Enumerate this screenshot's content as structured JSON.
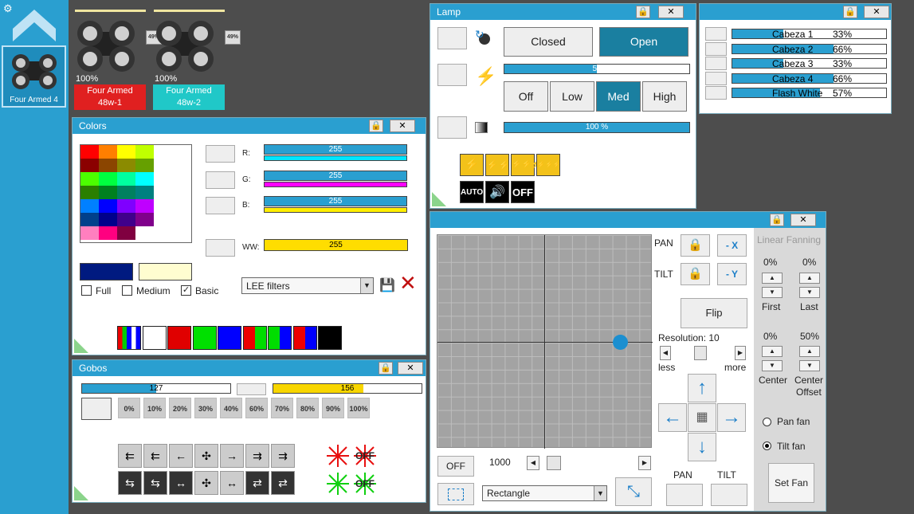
{
  "sidebar": {
    "item_label": "Four Armed 4"
  },
  "fixtures": [
    {
      "pct": "100%",
      "badge": "49%",
      "name_line1": "Four Armed",
      "name_line2": "48w-1",
      "color": "#e02020"
    },
    {
      "pct": "100%",
      "badge": "49%",
      "name_line1": "Four Armed",
      "name_line2": "48w-2",
      "color": "#20c8c8"
    }
  ],
  "colors_win": {
    "title": "Colors",
    "palette": [
      "#ff0000",
      "#ff7f00",
      "#ffff00",
      "#bfff00",
      "#8b0000",
      "#8b4500",
      "#8b8b00",
      "#66a000",
      "#4cff00",
      "#00ff40",
      "#00ff9f",
      "#00ffff",
      "#2a7f00",
      "#00801f",
      "#00805f",
      "#008080",
      "#0080ff",
      "#0000ff",
      "#7f00ff",
      "#bf00ff",
      "#00408b",
      "#00008b",
      "#40008b",
      "#80008b",
      "#ff7fbf",
      "#ff0080",
      "#800040",
      "#ffffff"
    ],
    "channels": [
      {
        "label": "R:",
        "value": "255",
        "color": "#00e5ff"
      },
      {
        "label": "G:",
        "value": "255",
        "color": "#ff00ff"
      },
      {
        "label": "B:",
        "value": "255",
        "color": "#ffee00"
      },
      {
        "label": "WW:",
        "value": "255",
        "color": "#ffdd00"
      }
    ],
    "preview_dark": "#001a80",
    "preview_light": "#fffdd0",
    "checks": [
      {
        "label": "Full",
        "checked": false
      },
      {
        "label": "Medium",
        "checked": false
      },
      {
        "label": "Basic",
        "checked": true
      }
    ],
    "filter_select": "LEE filters",
    "swatches": [
      "multi",
      "#ffffff",
      "#e00000",
      "#00e000",
      "#0000ff",
      "rg",
      "gb",
      "rb",
      "#000000"
    ]
  },
  "gobos_win": {
    "title": "Gobos",
    "bar1_value": "127",
    "bar1_fraction": 0.5,
    "bar2_value": "156",
    "bar2_fraction": 0.61,
    "percents": [
      "0%",
      "10%",
      "20%",
      "30%",
      "40%",
      "60%",
      "70%",
      "80%",
      "90%",
      "100%"
    ]
  },
  "lamp_win": {
    "title": "Lamp",
    "closed_label": "Closed",
    "open_label": "Open",
    "strobe_value": "50",
    "strobe_fraction": 0.5,
    "power_labels": [
      "Off",
      "Low",
      "Med",
      "High"
    ],
    "power_selected": "Med",
    "dimmer_value": "100 %",
    "dimmer_fraction": 1.0,
    "auto_label": "AUTO",
    "off_label": "OFF"
  },
  "heads_win": {
    "heads": [
      {
        "name": "Cabeza 1",
        "pct": "33%",
        "fraction": 0.33
      },
      {
        "name": "Cabeza 2",
        "pct": "66%",
        "fraction": 0.66
      },
      {
        "name": "Cabeza 3",
        "pct": "33%",
        "fraction": 0.33
      },
      {
        "name": "Cabeza 4",
        "pct": "66%",
        "fraction": 0.66
      },
      {
        "name": "Flash White",
        "pct": "57%",
        "fraction": 0.57
      }
    ]
  },
  "position_win": {
    "pan_label": "PAN",
    "tilt_label": "TILT",
    "minus_x": "- X",
    "minus_y": "- Y",
    "flip_label": "Flip",
    "resolution": "Resolution: 10",
    "less": "less",
    "more": "more",
    "off_label": "OFF",
    "speed_value": "1000",
    "shape_select": "Rectangle",
    "bottom_pan": "PAN",
    "bottom_tilt": "TILT",
    "fanning": {
      "title": "Linear Fanning",
      "first_pct": "0%",
      "last_pct": "0%",
      "first": "First",
      "last": "Last",
      "center_pct": "0%",
      "offset_pct": "50%",
      "center": "Center",
      "center_offset_1": "Center",
      "center_offset_2": "Offset",
      "pan_fan": "Pan fan",
      "tilt_fan": "Tilt fan",
      "set_fan": "Set Fan"
    }
  }
}
